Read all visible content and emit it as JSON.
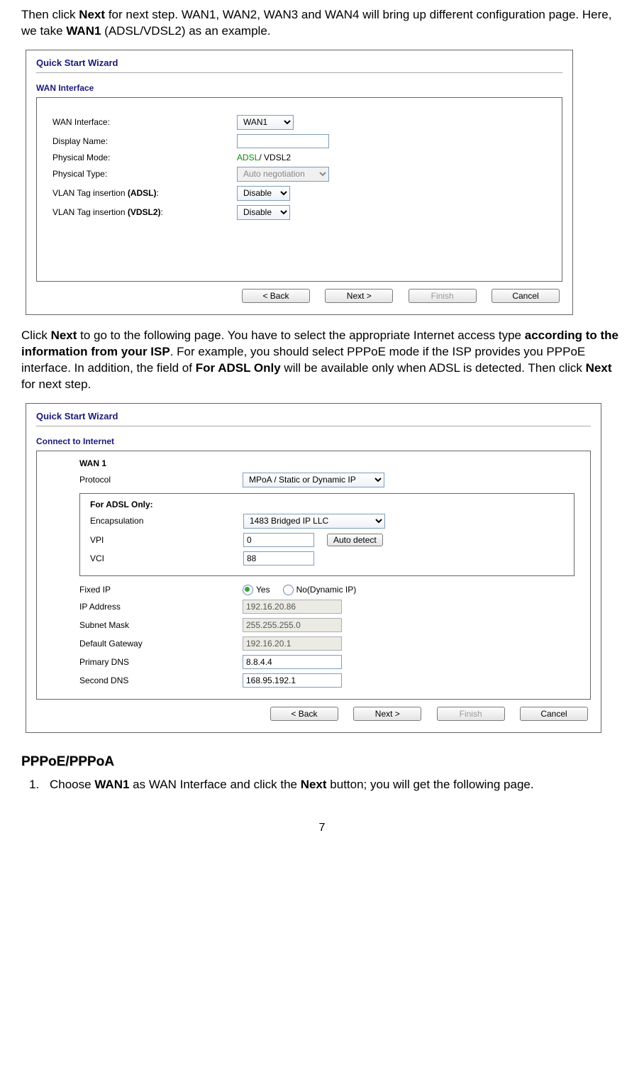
{
  "intro1": {
    "t1": "Then click ",
    "bNext": "Next",
    "t2": " for next step. WAN1, WAN2, WAN3 and WAN4 will bring up different configuration page. Here, we take ",
    "bWAN1": "WAN1",
    "t3": " (ADSL/VDSL2) as an example."
  },
  "ss1": {
    "title": "Quick Start Wizard",
    "section": "WAN Interface",
    "labels": {
      "wanInterface": "WAN Interface:",
      "displayName": "Display Name:",
      "physicalMode": "Physical Mode:",
      "physicalType": "Physical Type:",
      "vlanAdsl": "VLAN Tag insertion ",
      "vlanAdslB": "(ADSL)",
      "vlanAdslC": ":",
      "vlanVdsl": "VLAN Tag insertion ",
      "vlanVdslB": "(VDSL2)",
      "vlanVdslC": ":"
    },
    "values": {
      "wanSelect": "WAN1",
      "displayName": "",
      "modeGreen": "ADSL",
      "modeRest": " / VDSL2",
      "physType": "Auto negotiation",
      "vlanAdsl": "Disable",
      "vlanVdsl": "Disable"
    },
    "buttons": {
      "back": "< Back",
      "next": "Next >",
      "finish": "Finish",
      "cancel": "Cancel"
    }
  },
  "intro2": {
    "t1": "Click ",
    "bNext": "Next",
    "t2": " to go to the following page. You have to select the appropriate Internet access type ",
    "bAccording": "according to the information from your ISP",
    "t3": ". For example, you should select PPPoE mode if the ISP provides you PPPoE interface. In addition, the field of ",
    "bForAdsl": "For ADSL Only",
    "t4": " will be available only when ADSL is detected. Then click ",
    "bNext2": "Next",
    "t5": " for next step."
  },
  "ss2": {
    "title": "Quick Start Wizard",
    "section": "Connect to Internet",
    "wan1": "WAN 1",
    "labels": {
      "protocol": "Protocol",
      "adslOnly": "For ADSL Only:",
      "encap": "Encapsulation",
      "vpi": "VPI",
      "vci": "VCI",
      "fixedIp": "Fixed IP",
      "ip": "IP Address",
      "subnet": "Subnet Mask",
      "gateway": "Default Gateway",
      "pdns": "Primary DNS",
      "sdns": "Second DNS"
    },
    "values": {
      "protocol": "MPoA / Static or Dynamic IP",
      "encap": "1483 Bridged IP LLC",
      "vpi": "0",
      "vci": "88",
      "autodetect": "Auto detect",
      "yes": "Yes",
      "no": "No(Dynamic IP)",
      "ip": "192.16.20.86",
      "subnet": "255.255.255.0",
      "gateway": "192.16.20.1",
      "pdns": "8.8.4.4",
      "sdns": "168.95.192.1"
    },
    "buttons": {
      "back": "< Back",
      "next": "Next >",
      "finish": "Finish",
      "cancel": "Cancel"
    }
  },
  "heading": "PPPoE/PPPoA",
  "step1": {
    "t1": "Choose ",
    "bWAN1": "WAN1",
    "t2": " as WAN Interface and click the ",
    "bNext": "Next",
    "t3": " button; you will get the following page."
  },
  "pageNum": "7"
}
